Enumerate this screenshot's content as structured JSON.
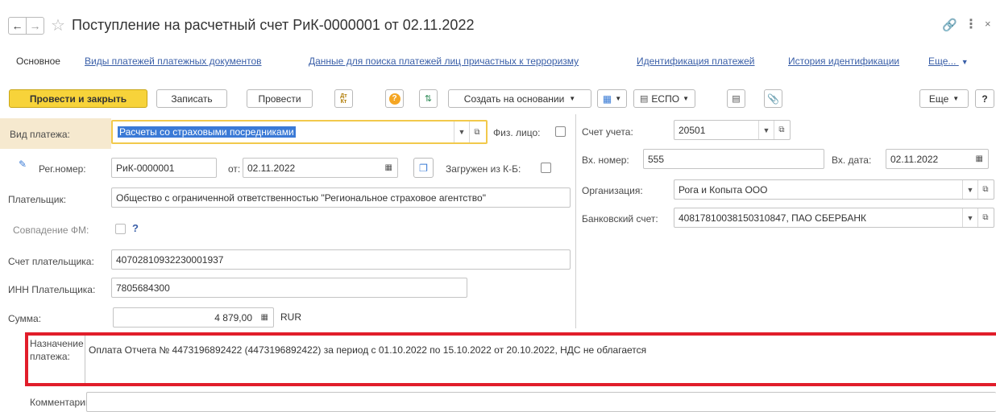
{
  "window": {
    "title": "Поступление на расчетный счет РиК-0000001 от 02.11.2022"
  },
  "nav": {
    "items": [
      "Основное",
      "Виды платежей платежных документов",
      "Данные для поиска платежей лиц причастных к терроризму",
      "Идентификация платежей",
      "История идентификации",
      "Еще..."
    ]
  },
  "toolbar": {
    "post_close": "Провести и закрыть",
    "save": "Записать",
    "post": "Провести",
    "dtkt": "Дт Кт",
    "help": "?",
    "create_based": "Создать на основании",
    "espo": "ЕСПО",
    "more": "Еще",
    "question": "?"
  },
  "form": {
    "payment_type_label": "Вид платежа:",
    "payment_type_value": "Расчеты со страховыми посредниками",
    "individual_label": "Физ. лицо:",
    "reg_number_label": "Рег.номер:",
    "reg_number_value": "РиК-0000001",
    "from_label": "от:",
    "date_value": "02.11.2022",
    "loaded_label": "Загружен из К-Б:",
    "payer_label": "Плательщик:",
    "payer_value": "Общество с ограниченной ответственностью \"Региональное страховое агентство\"",
    "fm_label": "Совпадение ФМ:",
    "fm_help": "?",
    "payer_account_label": "Счет плательщика:",
    "payer_account_value": "40702810932230001937",
    "inn_label": "ИНН Плательщика:",
    "inn_value": "7805684300",
    "sum_label": "Сумма:",
    "sum_value": "4 879,00",
    "currency": "RUR",
    "account_label": "Счет учета:",
    "account_value": "20501",
    "in_number_label": "Вх. номер:",
    "in_number_value": "555",
    "in_date_label": "Вх. дата:",
    "in_date_value": "02.11.2022",
    "org_label": "Организация:",
    "org_value": "Рога и Копыта ООО",
    "bank_label": "Банковский счет:",
    "bank_value": "40817810038150310847, ПАО СБЕРБАНК",
    "purpose_label_1": "Назначение",
    "purpose_label_2": "платежа:",
    "purpose_value": "Оплата Отчета № 4473196892422 (4473196892422) за период с 01.10.2022 по 15.10.2022 от 20.10.2022, НДС не облагается",
    "comment_label": "Комментарий:",
    "comment_value": ""
  },
  "colors": {
    "primary_button": "#f7d33a",
    "link": "#3a5fa8",
    "highlight_frame": "#e11d2a",
    "field_focus": "#f2c94c",
    "label_band": "#f6e9cf"
  }
}
